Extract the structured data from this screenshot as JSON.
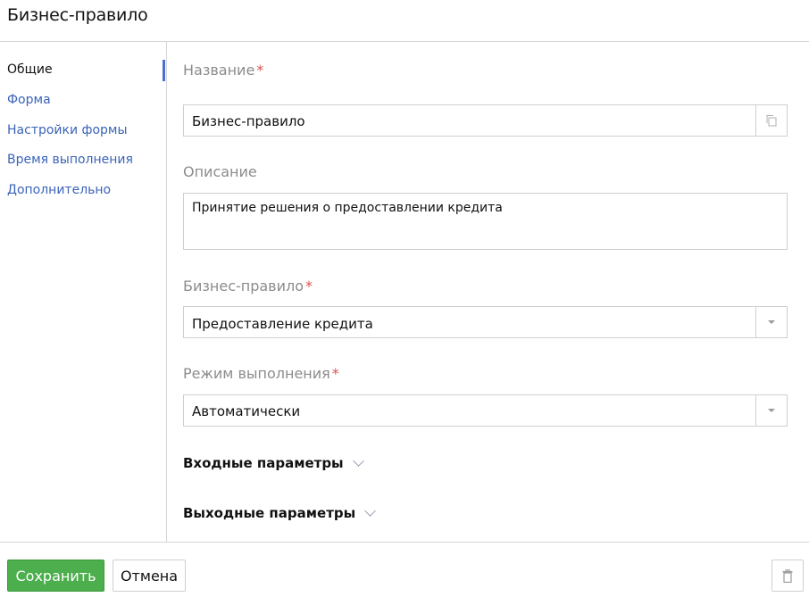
{
  "window": {
    "title": "Бизнес-правило"
  },
  "sidebar": {
    "items": [
      {
        "label": "Общие",
        "active": true
      },
      {
        "label": "Форма",
        "active": false
      },
      {
        "label": "Настройки формы",
        "active": false
      },
      {
        "label": "Время выполнения",
        "active": false
      },
      {
        "label": "Дополнительно",
        "active": false
      }
    ]
  },
  "form": {
    "name": {
      "label": "Название",
      "required_mark": "*",
      "value": "Бизнес-правило",
      "addon_icon": "copy-icon"
    },
    "description": {
      "label": "Описание",
      "value": "Принятие решения о предоставлении кредита"
    },
    "business_rule": {
      "label": "Бизнес-правило",
      "required_mark": "*",
      "value": "Предоставление кредита",
      "addon_icon": "caret-down-icon"
    },
    "execution_mode": {
      "label": "Режим выполнения",
      "required_mark": "*",
      "value": "Автоматически",
      "addon_icon": "caret-down-icon"
    },
    "sections": [
      {
        "label": "Входные параметры",
        "icon": "chevron-down-icon"
      },
      {
        "label": "Выходные параметры",
        "icon": "chevron-down-icon"
      }
    ]
  },
  "footer": {
    "save_label": "Сохранить",
    "cancel_label": "Отмена",
    "delete_icon": "trash-icon"
  },
  "colors": {
    "accent": "#4a6fcf",
    "link": "#3b64b8",
    "save": "#4cae4c",
    "required": "#d9534f"
  }
}
